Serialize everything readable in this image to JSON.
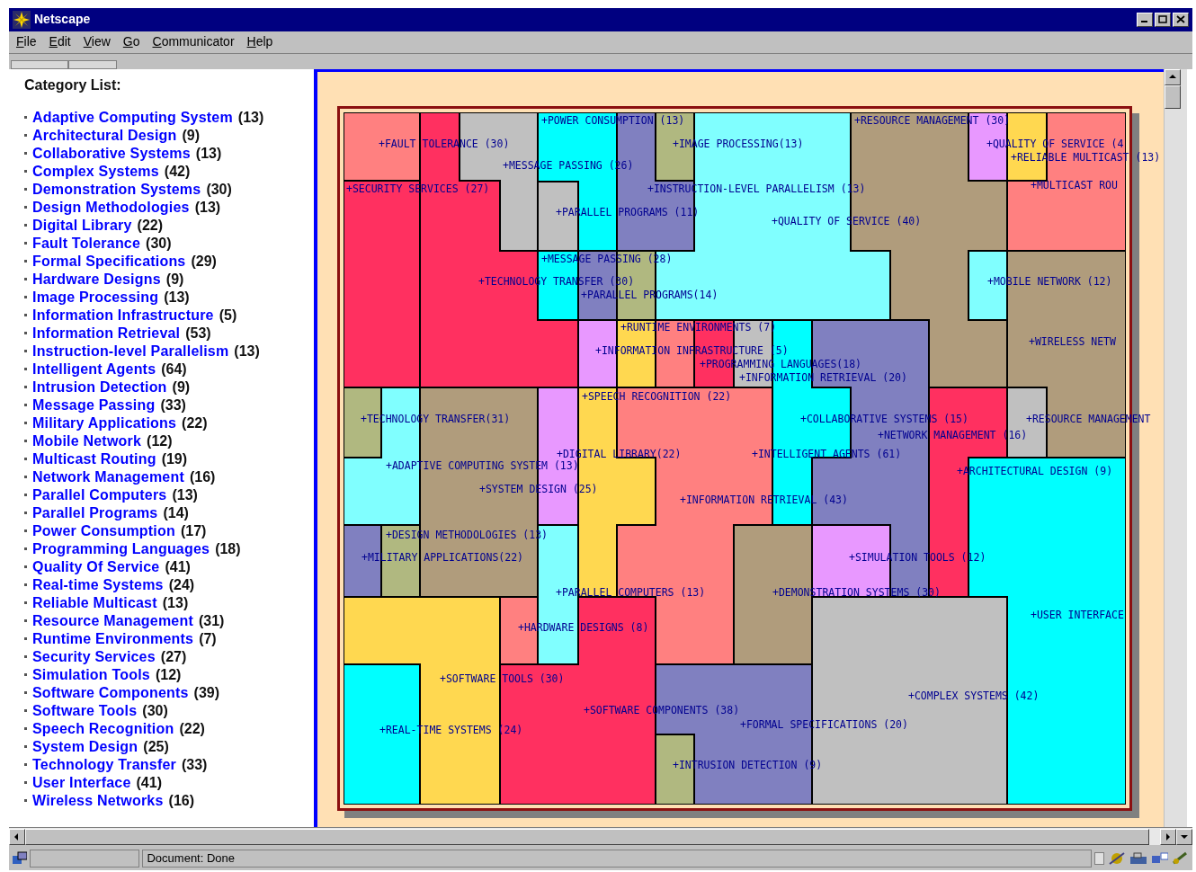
{
  "window": {
    "title": "Netscape"
  },
  "menu": [
    "File",
    "Edit",
    "View",
    "Go",
    "Communicator",
    "Help"
  ],
  "sidebar": {
    "heading": "Category List:",
    "items": [
      {
        "name": "Adaptive Computing System",
        "count": "(13)"
      },
      {
        "name": "Architectural Design",
        "count": "(9)"
      },
      {
        "name": "Collaborative Systems",
        "count": "(13)"
      },
      {
        "name": "Complex Systems",
        "count": "(42)"
      },
      {
        "name": "Demonstration Systems",
        "count": "(30)"
      },
      {
        "name": "Design Methodologies",
        "count": "(13)"
      },
      {
        "name": "Digital Library",
        "count": "(22)"
      },
      {
        "name": "Fault Tolerance",
        "count": "(30)"
      },
      {
        "name": "Formal Specifications",
        "count": "(29)"
      },
      {
        "name": "Hardware Designs",
        "count": "(9)"
      },
      {
        "name": "Image Processing",
        "count": "(13)"
      },
      {
        "name": "Information Infrastructure",
        "count": "(5)"
      },
      {
        "name": "Information Retrieval",
        "count": "(53)"
      },
      {
        "name": "Instruction-level Parallelism",
        "count": "(13)"
      },
      {
        "name": "Intelligent Agents",
        "count": "(64)"
      },
      {
        "name": "Intrusion Detection",
        "count": "(9)"
      },
      {
        "name": "Message Passing",
        "count": "(33)"
      },
      {
        "name": "Military Applications",
        "count": "(22)"
      },
      {
        "name": "Mobile Network",
        "count": "(12)"
      },
      {
        "name": "Multicast Routing",
        "count": "(19)"
      },
      {
        "name": "Network Management",
        "count": "(16)"
      },
      {
        "name": "Parallel Computers",
        "count": "(13)"
      },
      {
        "name": "Parallel Programs",
        "count": "(14)"
      },
      {
        "name": "Power Consumption",
        "count": "(17)"
      },
      {
        "name": "Programming Languages",
        "count": "(18)"
      },
      {
        "name": "Quality Of Service",
        "count": "(41)"
      },
      {
        "name": "Real-time Systems",
        "count": "(24)"
      },
      {
        "name": "Reliable Multicast",
        "count": "(13)"
      },
      {
        "name": "Resource Management",
        "count": "(31)"
      },
      {
        "name": "Runtime Environments",
        "count": "(7)"
      },
      {
        "name": "Security Services",
        "count": "(27)"
      },
      {
        "name": "Simulation Tools",
        "count": "(12)"
      },
      {
        "name": "Software Components",
        "count": "(39)"
      },
      {
        "name": "Software Tools",
        "count": "(30)"
      },
      {
        "name": "Speech Recognition",
        "count": "(22)"
      },
      {
        "name": "System Design",
        "count": "(25)"
      },
      {
        "name": "Technology Transfer",
        "count": "(33)"
      },
      {
        "name": "User Interface",
        "count": "(41)"
      },
      {
        "name": "Wireless Networks",
        "count": "(16)"
      }
    ]
  },
  "map": {
    "labels": [
      "+FAULT TOLERANCE (30)",
      "+POWER CONSUMPTION (13)",
      "+IMAGE PROCESSING(13)",
      "+RESOURCE MANAGEMENT (30)",
      "+QUALITY OF SERVICE (4",
      "+RELIABLE MULTICAST (13)",
      "+MESSAGE PASSING (26)",
      "+SECURITY SERVICES (27)",
      "+INSTRUCTION-LEVEL PARALLELISM (13)",
      "+MULTICAST ROU",
      "+PARALLEL PROGRAMS (11)",
      "+QUALITY OF SERVICE (40)",
      "+MESSAGE PASSING (28)",
      "+TECHNOLOGY TRANSFER (30)",
      "+PARALLEL PROGRAMS(14)",
      "+MOBILE NETWORK (12)",
      "+RUNTIME ENVIRONMENTS (7)",
      "+INFORMATION INFRASTRUCTURE (5)",
      "+WIRELESS NETW",
      "+PROGRAMMING LANGUAGES(18)",
      "+INFORMATION RETRIEVAL (20)",
      "+SPEECH RECOGNITION (22)",
      "+TECHNOLOGY TRANSFER(31)",
      "+COLLABORATIVE SYSTEMS (15)",
      "+RESOURCE MANAGEMENT",
      "+NETWORK MANAGEMENT (16)",
      "+DIGITAL LIBRARY(22)",
      "+INTELLIGENT AGENTS (61)",
      "+ADAPTIVE COMPUTING SYSTEM (13)",
      "+ARCHITECTURAL DESIGN (9)",
      "+SYSTEM DESIGN (25)",
      "+INFORMATION RETRIEVAL (43)",
      "+DESIGN METHODOLOGIES (13)",
      "+MILITARY APPLICATIONS(22)",
      "+SIMULATION TOOLS (12)",
      "+PARALLEL COMPUTERS (13)",
      "+DEMONSTRATION SYSTEMS (30)",
      "+USER INTERFACE",
      "+HARDWARE DESIGNS (8)",
      "+SOFTWARE TOOLS (30)",
      "+COMPLEX SYSTEMS (42)",
      "+SOFTWARE COMPONENTS (38)",
      "+FORMAL SPECIFICATIONS (20)",
      "+REAL-TIME SYSTEMS (24)",
      "+INTRUSION DETECTION (9)"
    ]
  },
  "status_bar": {
    "text": "Document: Done"
  }
}
